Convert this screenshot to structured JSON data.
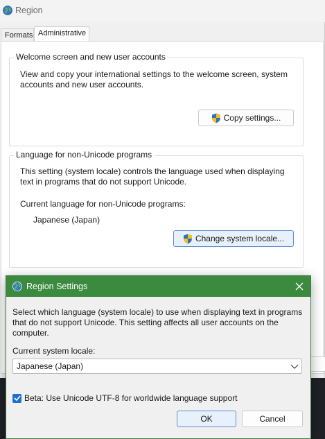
{
  "window": {
    "title": "Region",
    "icon": "globe-region-icon"
  },
  "tabs": [
    {
      "label": "Formats",
      "selected": false
    },
    {
      "label": "Administrative",
      "selected": true
    }
  ],
  "welcome_group": {
    "title": "Welcome screen and new user accounts",
    "description_line1": "View and copy your international settings to the welcome screen, system",
    "description_line2": "accounts and new user accounts.",
    "copy_button_label": "Copy settings..."
  },
  "unicode_group": {
    "title": "Language for non-Unicode programs",
    "description_line1": "This setting (system locale) controls the language used when displaying",
    "description_line2": "text in programs that do not support Unicode.",
    "current_label": "Current language for non-Unicode programs:",
    "current_value": "Japanese (Japan)",
    "change_button_label": "Change system locale..."
  },
  "dialog": {
    "title": "Region Settings",
    "description_line1": "Select which language (system locale) to use when displaying text in programs",
    "description_line2": "that do not support Unicode. This setting affects all user accounts on the",
    "description_line3": "computer.",
    "locale_label": "Current system locale:",
    "locale_value": "Japanese (Japan)",
    "beta_checkbox_label": "Beta: Use Unicode UTF-8 for worldwide language support",
    "beta_checked": true,
    "ok_label": "OK",
    "cancel_label": "Cancel",
    "accent_color": "#3b8a3e"
  }
}
